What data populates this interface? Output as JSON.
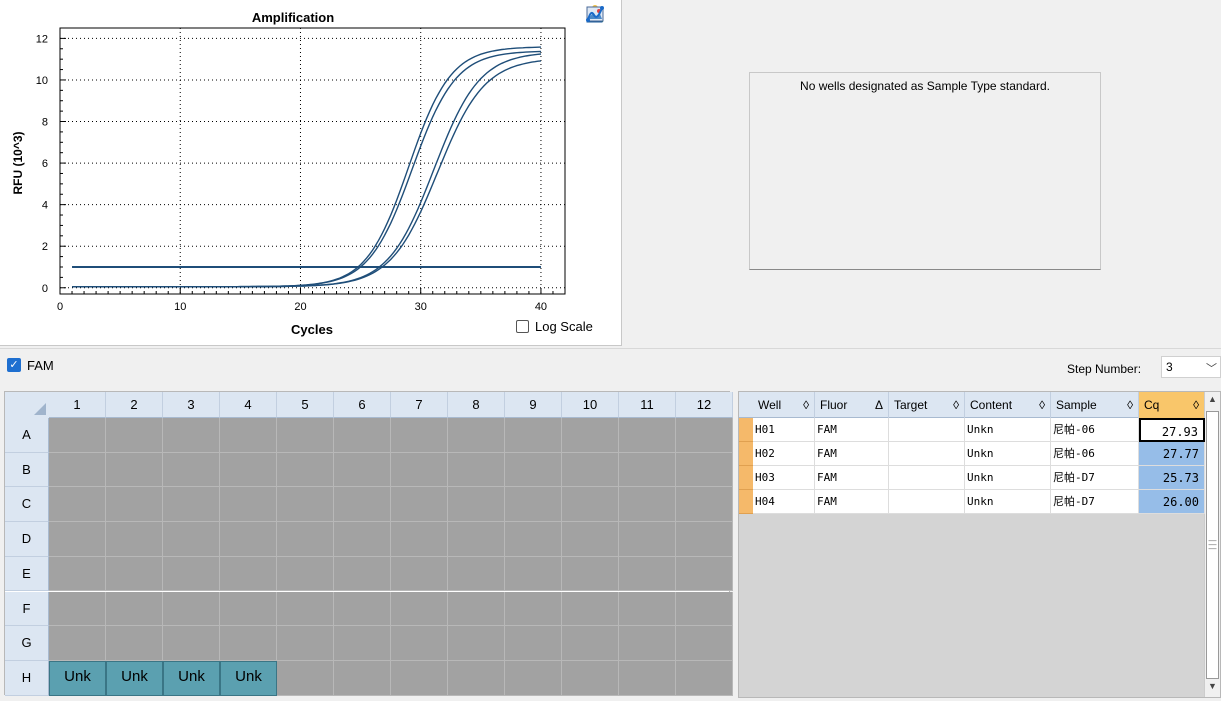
{
  "amplification": {
    "tools": [
      "copy-icon",
      "chart-settings-icon",
      "export-icon",
      "image-icon",
      "curve-icon"
    ],
    "log_scale_label": "Log Scale"
  },
  "chart_data": {
    "type": "line",
    "title": "Amplification",
    "xlabel": "Cycles",
    "ylabel": "RFU (10^3)",
    "xlim": [
      0,
      42
    ],
    "ylim": [
      -0.3,
      12.5
    ],
    "xticks": [
      0,
      10,
      20,
      30,
      40
    ],
    "yticks": [
      0,
      2,
      4,
      6,
      8,
      10,
      12
    ],
    "grid": true,
    "line_color": "#1f4e79",
    "threshold": 1.0,
    "series": [
      {
        "plateau": 11.55,
        "midpoint": 29.0,
        "slope": 1.75
      },
      {
        "plateau": 11.35,
        "midpoint": 29.3,
        "slope": 1.8
      },
      {
        "plateau": 11.3,
        "midpoint": 31.1,
        "slope": 1.9
      },
      {
        "plateau": 11.0,
        "midpoint": 31.4,
        "slope": 1.95
      }
    ]
  },
  "standard_curve": {
    "message": "No wells designated as Sample Type standard."
  },
  "fluor_bar": {
    "fam_label": "FAM",
    "step_label": "Step Number:",
    "step_value": "3"
  },
  "plate": {
    "columns": [
      "1",
      "2",
      "3",
      "4",
      "5",
      "6",
      "7",
      "8",
      "9",
      "10",
      "11",
      "12"
    ],
    "rows": [
      "A",
      "B",
      "C",
      "D",
      "E",
      "F",
      "G",
      "H"
    ],
    "unk_label": "Unk"
  },
  "results": {
    "headers": [
      "Well",
      "Fluor",
      "Target",
      "Content",
      "Sample",
      "Cq"
    ],
    "sort_glyphs": [
      "◊",
      "Δ",
      "◊",
      "◊",
      "◊",
      "◊"
    ],
    "rows": [
      {
        "well": "H01",
        "fluor": "FAM",
        "target": "",
        "content": "Unkn",
        "sample": "尼帕-06",
        "cq": "27.93"
      },
      {
        "well": "H02",
        "fluor": "FAM",
        "target": "",
        "content": "Unkn",
        "sample": "尼帕-06",
        "cq": "27.77"
      },
      {
        "well": "H03",
        "fluor": "FAM",
        "target": "",
        "content": "Unkn",
        "sample": "尼帕-D7",
        "cq": "25.73"
      },
      {
        "well": "H04",
        "fluor": "FAM",
        "target": "",
        "content": "Unkn",
        "sample": "尼帕-D7",
        "cq": "26.00"
      }
    ]
  }
}
